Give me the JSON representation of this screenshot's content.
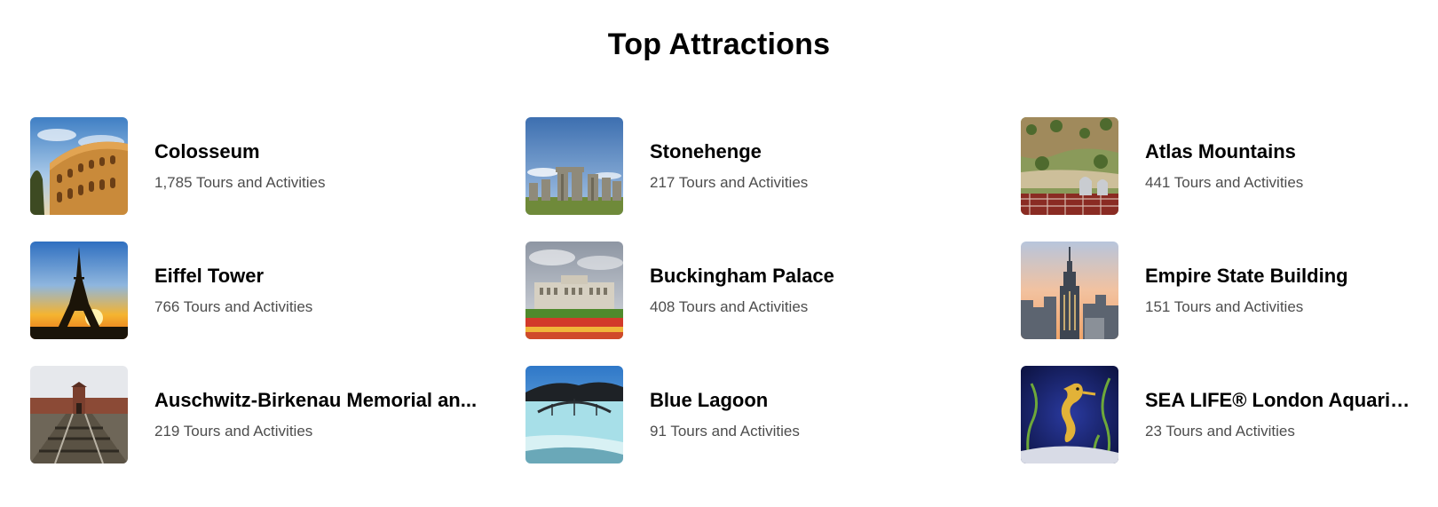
{
  "section": {
    "title": "Top Attractions"
  },
  "attractions": [
    {
      "name": "Colosseum",
      "count": "1,785 Tours and Activities",
      "image": "colosseum-image"
    },
    {
      "name": "Stonehenge",
      "count": "217 Tours and Activities",
      "image": "stonehenge-image"
    },
    {
      "name": "Atlas Mountains",
      "count": "441 Tours and Activities",
      "image": "atlas-mountains-image"
    },
    {
      "name": "Eiffel Tower",
      "count": "766 Tours and Activities",
      "image": "eiffel-tower-image"
    },
    {
      "name": "Buckingham Palace",
      "count": "408 Tours and Activities",
      "image": "buckingham-palace-image"
    },
    {
      "name": "Empire State Building",
      "count": "151 Tours and Activities",
      "image": "empire-state-building-image"
    },
    {
      "name": "Auschwitz-Birkenau Memorial an...",
      "count": "219 Tours and Activities",
      "image": "auschwitz-birkenau-image"
    },
    {
      "name": "Blue Lagoon",
      "count": "91 Tours and Activities",
      "image": "blue-lagoon-image"
    },
    {
      "name": "SEA LIFE® London Aquarium",
      "count": "23 Tours and Activities",
      "image": "sea-life-aquarium-image"
    }
  ]
}
